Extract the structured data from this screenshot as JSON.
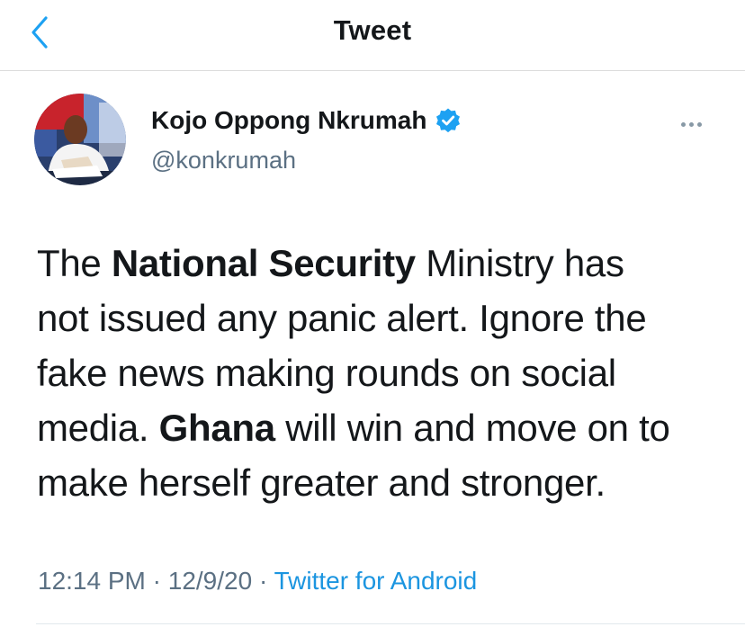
{
  "header": {
    "title": "Tweet",
    "back_icon": "chevron-left-icon"
  },
  "author": {
    "name": "Kojo Oppong Nkrumah",
    "handle": "@konkrumah",
    "verified_icon": "verified-badge-icon",
    "avatar_icon": "avatar-photo"
  },
  "more_icon": "more-dots-icon",
  "tweet": {
    "line1_pre": "The ",
    "line1_bold": "National Security",
    "line1_post": " Ministry has",
    "line2": "not issued any panic alert. Ignore the",
    "line3": "fake news making rounds on social",
    "line4_pre": "media. ",
    "line4_bold": "Ghana",
    "line4_post": " will win and move on to",
    "line5": "make herself greater and stronger."
  },
  "meta": {
    "time": "12:14 PM",
    "sep1": " · ",
    "date": "12/9/20",
    "sep2": " · ",
    "source": "Twitter for Android"
  },
  "colors": {
    "accent": "#1b95e0",
    "verified": "#1da1f2",
    "secondary_text": "#5b7083"
  }
}
